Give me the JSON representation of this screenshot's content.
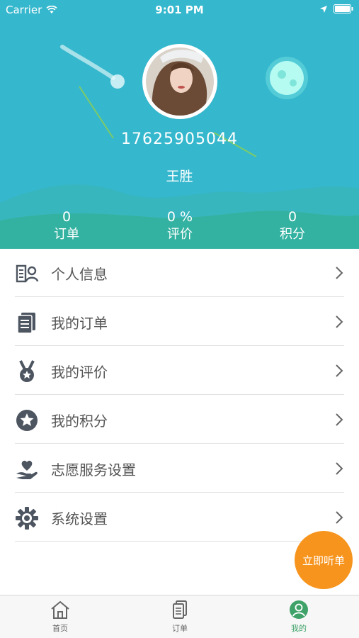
{
  "status_bar": {
    "carrier": "Carrier",
    "time": "9:01 PM"
  },
  "profile": {
    "phone": "17625905044",
    "name": "王胜"
  },
  "stats": [
    {
      "value": "0",
      "label": "订单"
    },
    {
      "value": "0 %",
      "label": "评价"
    },
    {
      "value": "0",
      "label": "积分"
    }
  ],
  "menu": [
    {
      "label": "个人信息",
      "icon": "id-card-icon"
    },
    {
      "label": "我的订单",
      "icon": "document-icon"
    },
    {
      "label": "我的评价",
      "icon": "medal-icon"
    },
    {
      "label": "我的积分",
      "icon": "star-circle-icon"
    },
    {
      "label": "志愿服务设置",
      "icon": "hand-heart-icon"
    },
    {
      "label": "系统设置",
      "icon": "gear-icon"
    }
  ],
  "fab": {
    "label": "立即听单",
    "color": "#f7941d"
  },
  "tabs": [
    {
      "label": "首页",
      "icon": "home-icon"
    },
    {
      "label": "订单",
      "icon": "document-icon"
    },
    {
      "label": "我的",
      "icon": "person-icon"
    }
  ],
  "colors": {
    "header": "#35b7cd",
    "active_tab": "#3fa268",
    "icon": "#4d5560"
  }
}
